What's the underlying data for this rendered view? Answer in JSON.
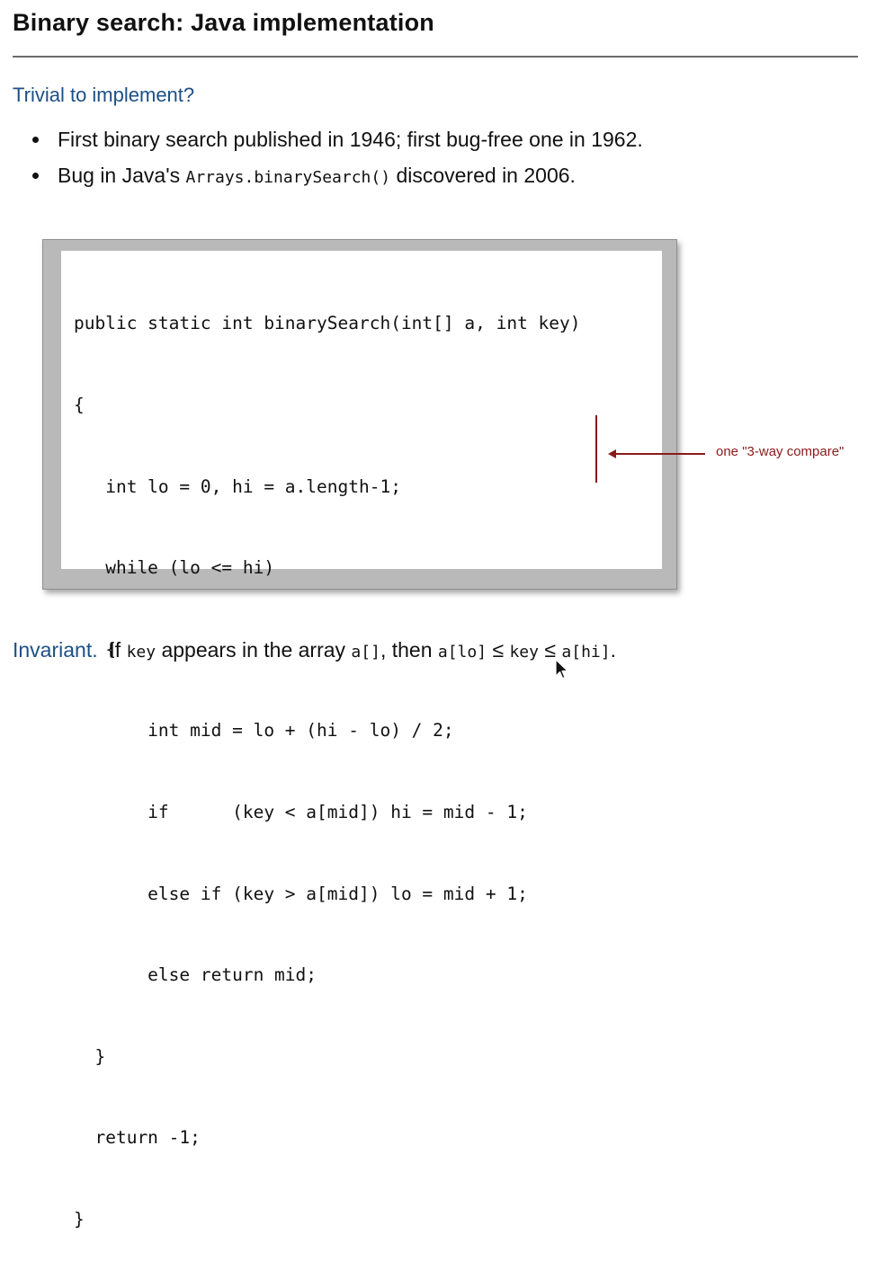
{
  "slide": {
    "title": "Binary search:  Java implementation"
  },
  "subtitle": "Trivial to implement?",
  "bullets": [
    {
      "text": "First binary search published in 1946; first bug-free one in 1962."
    },
    {
      "before": "Bug in Java's ",
      "code": "Arrays.binarySearch()",
      "after": " discovered in 2006."
    }
  ],
  "code_lines": [
    "public static int binarySearch(int[] a, int key)",
    "{",
    "   int lo = 0, hi = a.length-1;",
    "   while (lo <= hi)",
    "   {",
    "       int mid = lo + (hi - lo) / 2;",
    "       if      (key < a[mid]) hi = mid - 1;",
    "       else if (key > a[mid]) lo = mid + 1;",
    "       else return mid;",
    "  }",
    "  return -1;",
    "}"
  ],
  "annotation": "one \"3-way compare\"",
  "invariant": {
    "label": "Invariant.",
    "t1": "  If ",
    "c1": "key",
    "t2": " appears in the array ",
    "c2": "a[]",
    "t3": ", then ",
    "c3": "a[lo]",
    "t4": " ≤ ",
    "c4": "key",
    "t5": " ≤ ",
    "c5": "a[hi]",
    "t6": "."
  },
  "colors": {
    "heading_blue": "#1d4f86",
    "annotation_red": "#8b1a1a",
    "frame_gray": "#b9b9b9"
  },
  "icons": {
    "cursor": "arrow-cursor-icon"
  }
}
